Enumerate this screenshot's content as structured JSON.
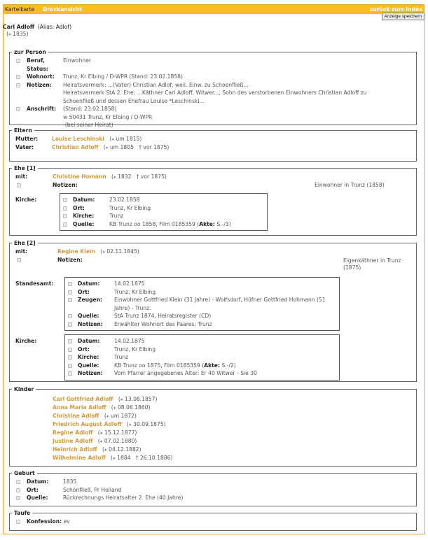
{
  "header": {
    "tab_karteikarte": "Karteikarte",
    "tab_druckansicht": "Druckansicht",
    "back_link": "zurück zum Index",
    "save_button": "Anzeige speichern"
  },
  "person": {
    "name": "Carl Adloff",
    "alias": "(Alias: Adlof)",
    "birth": "(⁎ 1835)"
  },
  "zur_person": {
    "legend": "zur Person",
    "beruf_label": "Beruf, Status:",
    "beruf": "Einwohner",
    "wohnort_label": "Wohnort:",
    "wohnort": "Trunz, Kr Elbing / D-WPR (Stand: 23.02.1858)",
    "notizen_label": "Notizen:",
    "notizen_1": "Heiratsvermerk: ...(Vater) Christian Adlof, weil. Einw. zu Schoenfließ...",
    "notizen_2": "Heiratsvermerk StA 2. Ehe: ...Käthner Carl Adloff, Witwer..., Sohn des verstorbenen Einwohners Christian Adloff zu Schoenfließ und dessen Ehefrau Louise *Leschinski...",
    "anschrift_label": "Anschrift:",
    "anschrift_1": "(Stand: 23.02.1858)",
    "anschrift_2": "w 50431 Trunz, Kr Elbing / D-WPR",
    "anschrift_3": "-(bei seiner Heirat)"
  },
  "eltern": {
    "legend": "Eltern",
    "mutter_label": "Mutter:",
    "mutter": "Louise Leschinski",
    "mutter_dates": "(⁎ um 1815)",
    "vater_label": "Vater:",
    "vater": "Christian Adloff",
    "vater_dates": "(⁎ um 1805   † vor 1875)"
  },
  "ehe1": {
    "legend": "Ehe [1]",
    "mit_label": "mit:",
    "partner": "Christine Homann",
    "partner_dates": "(⁎ 1832   † vor 1875)",
    "notizen_label": "Notizen:",
    "notizen": "Einwohner in Trunz (1858)",
    "kirche_label": "Kirche:",
    "kirche": [
      {
        "label": "Datum:",
        "value": "23.02.1858"
      },
      {
        "label": "Ort:",
        "value": "Trunz, Kr Elbing"
      },
      {
        "label": "Kirche:",
        "value": "Trunz"
      },
      {
        "label": "Quelle:",
        "value": "KB Trunz oo 1858, Film 0185359 (",
        "akte_label": "Akte:",
        "akte": " S.-/3)"
      }
    ]
  },
  "ehe2": {
    "legend": "Ehe [2]",
    "mit_label": "mit:",
    "partner": "Regine Klein",
    "partner_dates": "(⁎ 02.11.1845)",
    "notizen_label": "Notizen:",
    "notizen": "Eigenkäthner in Trunz (1875)",
    "standesamt_label": "Standesamt:",
    "kirche_label": "Kirche:",
    "standesamt": [
      {
        "label": "Datum:",
        "value": "14.02.1875"
      },
      {
        "label": "Ort:",
        "value": "Trunz, Kr Elbing"
      },
      {
        "label": "Zeugen:",
        "value": "Einwohner Gottfried Klein (31 Jahre) - Wolfsdorf, Hüfner Gottfried Hohmann (51 Jahre) - Trunz."
      },
      {
        "label": "Quelle:",
        "value": "StA Trunz 1874, Heiratsregister (CD)"
      },
      {
        "label": "Notizen:",
        "value": "Erwählter Wohnort des Paares: Trunz"
      }
    ],
    "kirche": [
      {
        "label": "Datum:",
        "value": "14.02.1875"
      },
      {
        "label": "Ort:",
        "value": "Trunz, Kr Elbing"
      },
      {
        "label": "Kirche:",
        "value": "Trunz"
      },
      {
        "label": "Quelle:",
        "value": "KB Trunz oo 1875, Film 0185359 (",
        "akte_label": "Akte:",
        "akte": " S.-/2)"
      },
      {
        "label": "Notizen:",
        "value": "Vom Pfarrer angegebenes Alter: Er 40 Witwer - Sie 30"
      }
    ]
  },
  "kinder": {
    "legend": "Kinder",
    "items": [
      {
        "name": "Carl Gottfried Adloff",
        "dates": "(⁎ 13.08.1857)"
      },
      {
        "name": "Anna Maria Adloff",
        "dates": "(⁎ 08.06.1860)"
      },
      {
        "name": "Christine Adloff",
        "dates": "(⁎ um 1872)"
      },
      {
        "name": "Friedrich August Adloff",
        "dates": "(⁎ 30.09.1875)"
      },
      {
        "name": "Regine Adloff",
        "dates": "(⁎ 15.12.1877)"
      },
      {
        "name": "Justine Adloff",
        "dates": "(⁎ 07.02.1880)"
      },
      {
        "name": "Heinrich Adloff",
        "dates": "(⁎ 04.12.1882)"
      },
      {
        "name": "Wilhelmine Adloff",
        "dates": "(⁎ 1884   † 26.10.1886)"
      }
    ]
  },
  "geburt": {
    "legend": "Geburt",
    "datum_label": "Datum:",
    "datum": "1835",
    "ort_label": "Ort:",
    "ort": "Schönfließ, Pr Holland",
    "quelle_label": "Quelle:",
    "quelle": "Rückrechnungs Heiratsalter 2. Ehe (40 Jahre)"
  },
  "taufe": {
    "legend": "Taufe",
    "konfession_label": "Konfession:",
    "konfession": "ev"
  },
  "colors": {
    "accent": "#fbbd24",
    "link": "#d49a3a"
  }
}
